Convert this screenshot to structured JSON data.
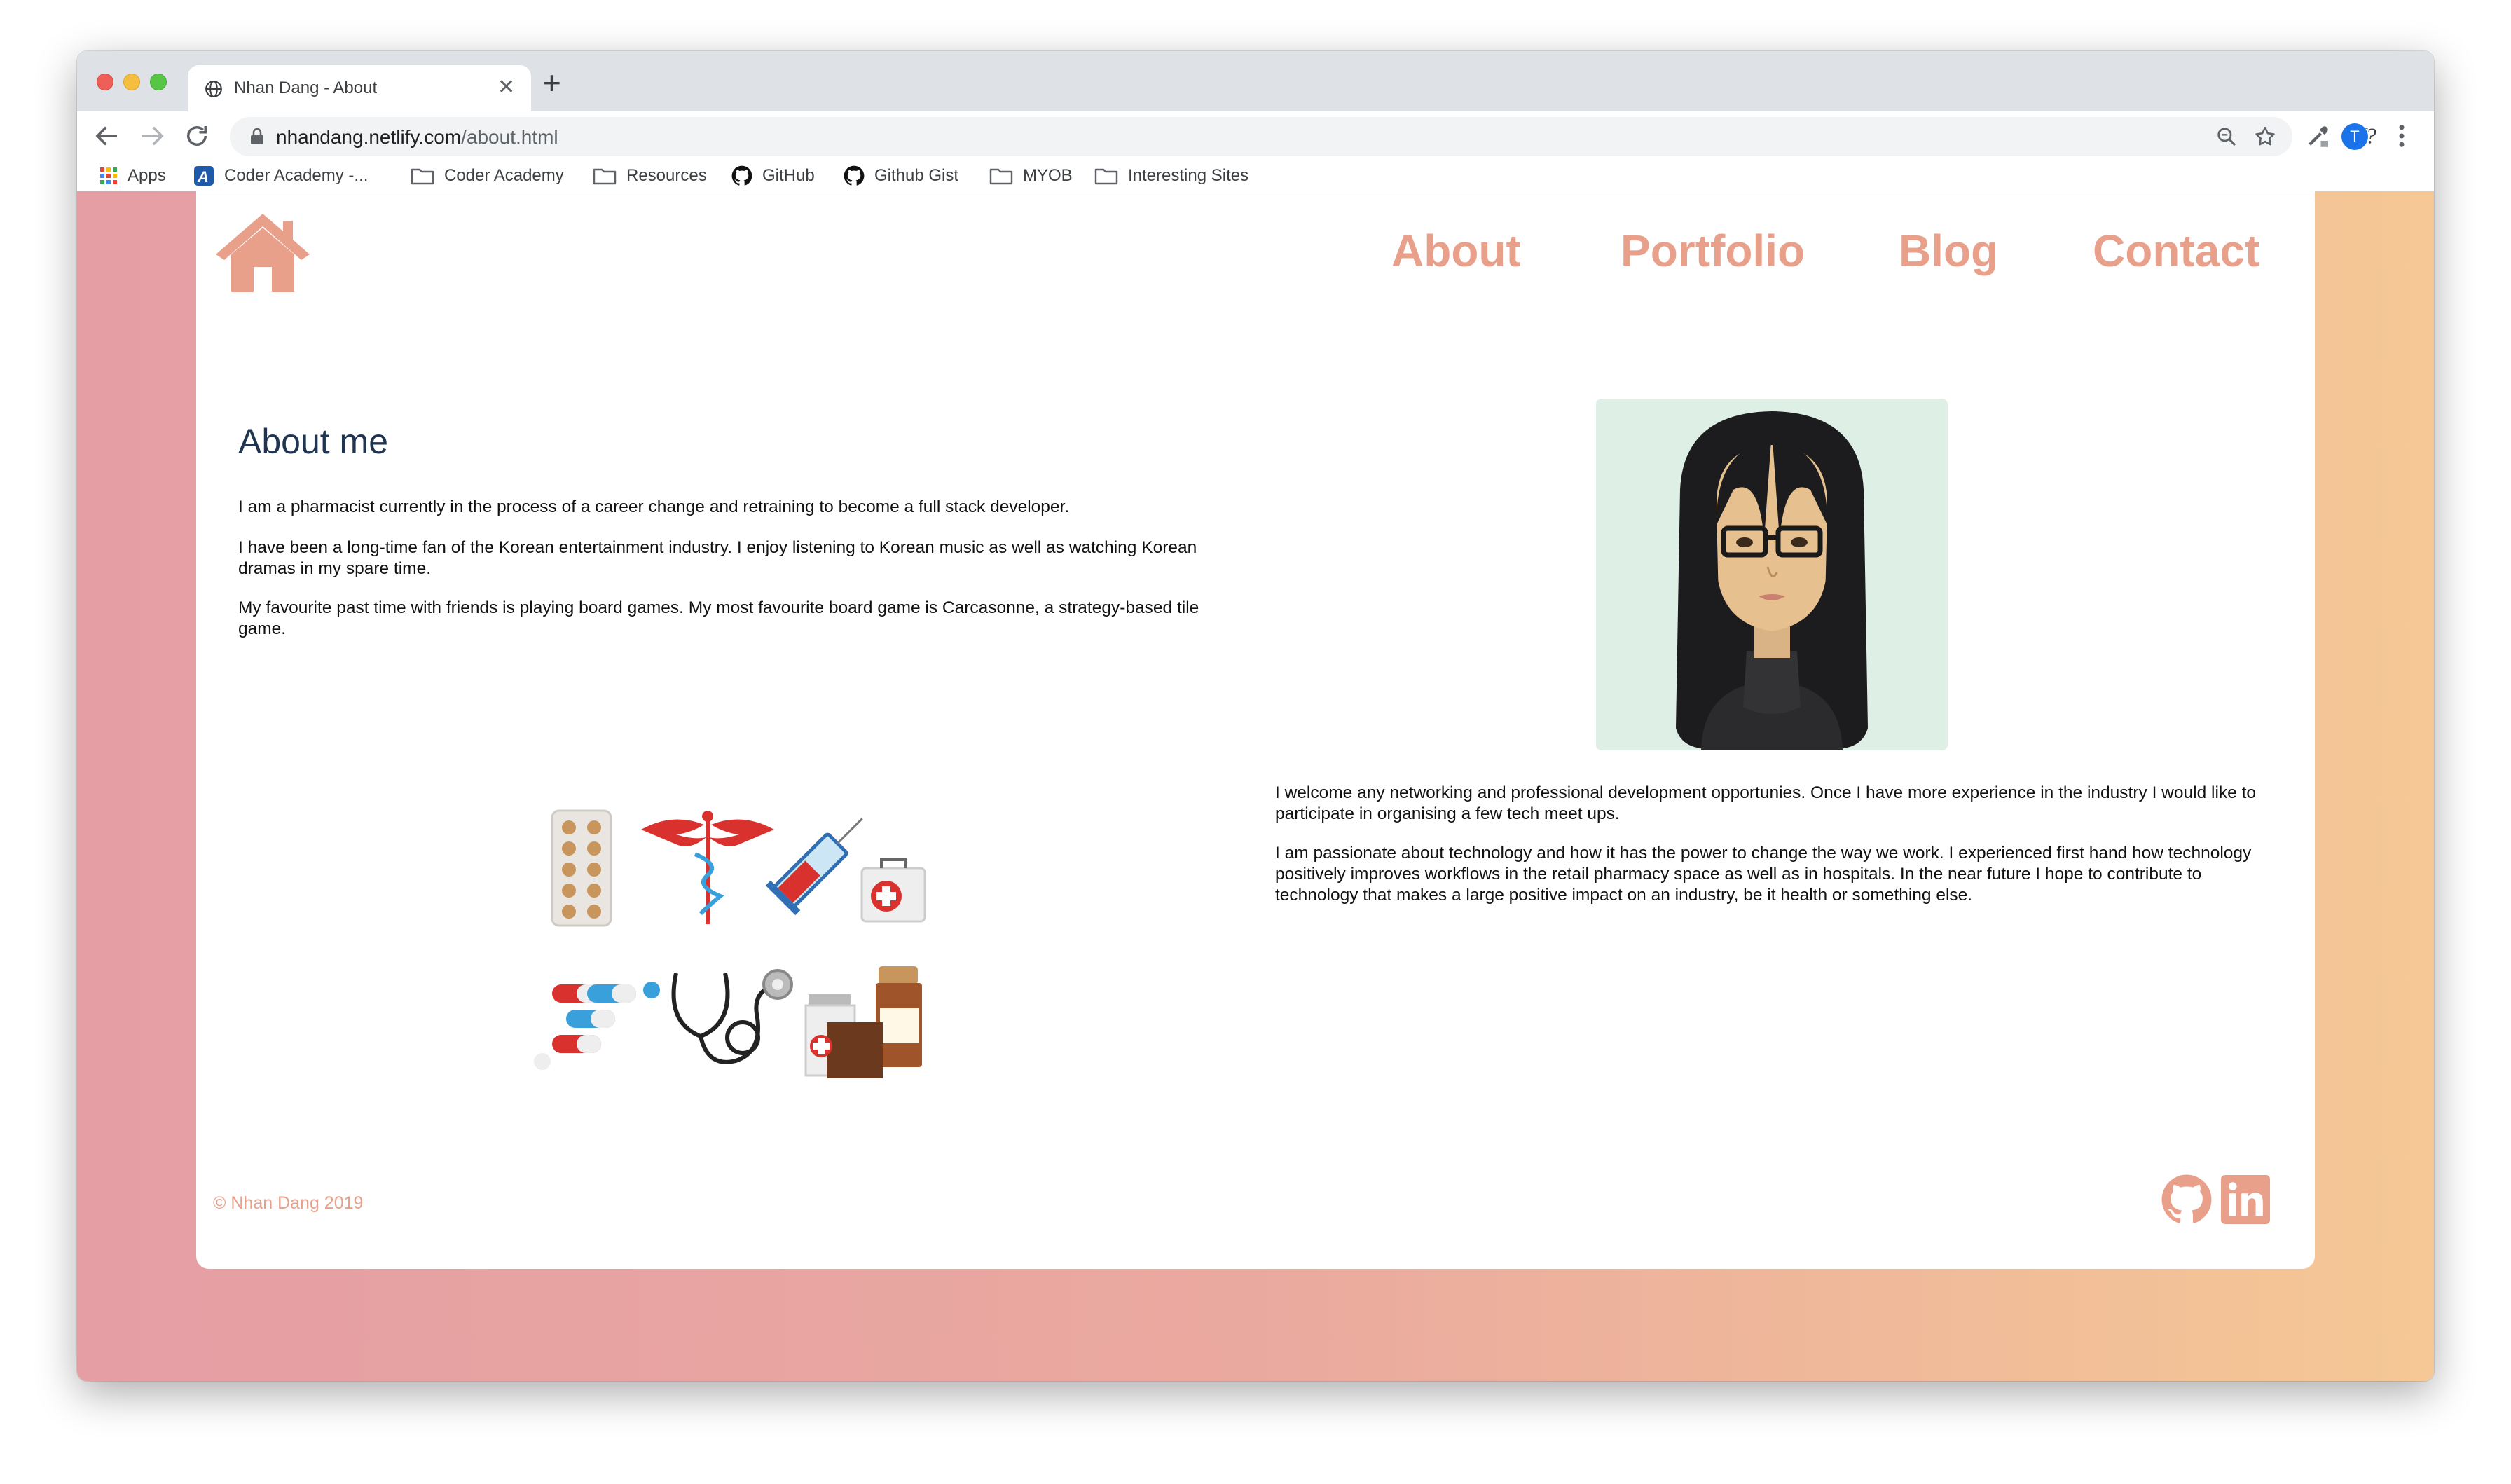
{
  "browser": {
    "tab_title": "Nhan Dang - About",
    "new_tab_label": "+",
    "tab_close_label": "✕",
    "url_domain": "nhandang.netlify.com",
    "url_path": "/about.html",
    "profile_initial": "T",
    "bookmarks": [
      {
        "label": "Apps",
        "icon": "apps-grid-icon"
      },
      {
        "label": "Coder Academy -...",
        "icon": "coder-academy-icon"
      },
      {
        "label": "Coder Academy",
        "icon": "folder-icon"
      },
      {
        "label": "Resources",
        "icon": "folder-icon"
      },
      {
        "label": "GitHub",
        "icon": "github-icon"
      },
      {
        "label": "Github Gist",
        "icon": "github-icon"
      },
      {
        "label": "MYOB",
        "icon": "folder-icon"
      },
      {
        "label": "Interesting Sites",
        "icon": "folder-icon"
      }
    ]
  },
  "nav": {
    "about": "About",
    "portfolio": "Portfolio",
    "blog": "Blog",
    "contact": "Contact"
  },
  "about": {
    "heading": "About me",
    "p1": "I am a pharmacist currently in the process of a career change and retraining to become a full stack developer.",
    "p2": "I have been a long-time fan of the Korean entertainment industry. I enjoy listening to Korean music as well as watching Korean dramas in my spare time.",
    "p3": "My favourite past time with friends is playing board games. My most favourite board game is Carcasonne, a strategy-based tile game.",
    "p4": "I welcome any networking and professional development opportunies. Once I have more experience in the industry I would like to participate in organising a few tech meet ups.",
    "p5": "I am passionate about technology and how it has the power to change the way we work. I experienced first hand how technology positively improves workflows in the retail pharmacy space as well as in hospitals. In the near future I hope to contribute to technology that makes a large positive impact on an industry, be it health or something else."
  },
  "footer": {
    "copyright": "© Nhan Dang 2019"
  },
  "colors": {
    "accent": "#e8a08b",
    "heading": "#1f3550",
    "gradient_left": "#e59ea4",
    "gradient_right": "#f5c895"
  }
}
